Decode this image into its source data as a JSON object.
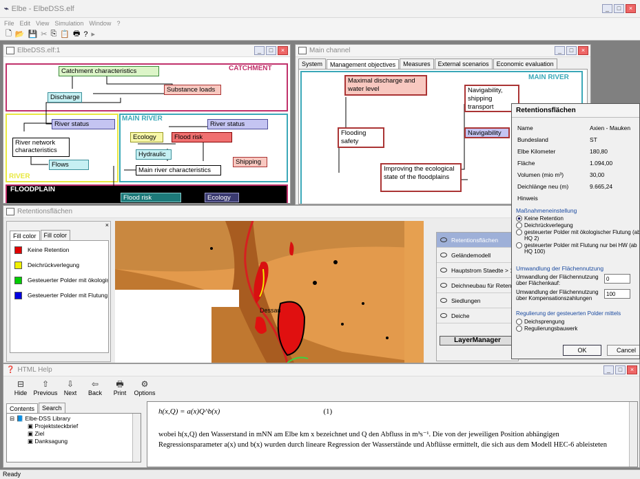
{
  "app": {
    "title": "Elbe - ElbeDSS.elf",
    "menu": [
      "File",
      "Edit",
      "View",
      "Simulation",
      "Window",
      "?"
    ],
    "status": "Ready"
  },
  "toolbar": {
    "icons": [
      "new-icon",
      "open-icon",
      "save-icon",
      "cut-icon",
      "copy-icon",
      "paste-icon",
      "print-icon",
      "help-icon",
      "run-icon"
    ]
  },
  "model_window": {
    "title": "ElbeDSS.elf:1",
    "regions": {
      "catchment": "CATCHMENT",
      "main_river": "MAIN RIVER",
      "river": "RIVER",
      "floodplain": "FLOODPLAIN"
    },
    "boxes": {
      "catchment_characteristics": "Catchment characteristics",
      "discharge": "Discharge",
      "substance_loads": "Substance loads",
      "river_status": "River status",
      "river_network": "River network characteristics",
      "flows": "Flows",
      "ecology": "Ecology",
      "flood_risk": "Flood risk",
      "main_river_status": "River status",
      "hydraulic": "Hydraulic",
      "shipping": "Shipping",
      "main_river_characteristics": "Main river characteristics",
      "fp_flood_risk": "Flood risk",
      "fp_ecology": "Ecology"
    }
  },
  "main_channel": {
    "title": "Main channel",
    "tabs": [
      "System",
      "Management objectives",
      "Measures",
      "External scenarios",
      "Economic evaluation"
    ],
    "active_tab": 1,
    "region": "MAIN RIVER",
    "boxes": {
      "maximal": "Maximal discharge and water level",
      "navigability_ship": "Navigability, shipping transport capacity",
      "flooding": "Flooding safety",
      "navigability": "Navigability",
      "improving": "Improving the ecological state of the floodplains"
    }
  },
  "retention_window": {
    "title": "Retentionsflächen",
    "legend_tabs": [
      "Fill color",
      "Fill color"
    ],
    "legend": [
      {
        "label": "Keine Retention",
        "color": "#e00000"
      },
      {
        "label": "Deichrückverlegung",
        "color": "#f0f000"
      },
      {
        "label": "Gesteuerter Polder mit ökologis",
        "color": "#00cc00"
      },
      {
        "label": "Gesteuerter Polder mit Flutung ü",
        "color": "#0000e0"
      }
    ],
    "map_label": "Dessau",
    "layers": [
      "Retentionsflächen",
      "Geländemodell",
      "Hauptstrom Staedte > 1",
      "Deichneubau für Reten",
      "Siedlungen",
      "Deiche"
    ],
    "layer_manager": "LayerManager"
  },
  "dialog": {
    "title": "Retentionsflächen",
    "fields": [
      {
        "label": "Name",
        "value": "Axien - Mauken"
      },
      {
        "label": "Bundesland",
        "value": "ST"
      },
      {
        "label": "Elbe Kilometer",
        "value": "180,80"
      },
      {
        "label": "Fläche",
        "value": "1.094,00"
      },
      {
        "label": "Volumen (mio m³)",
        "value": "30,00"
      },
      {
        "label": "Deichlänge neu (m)",
        "value": "9.665,24"
      },
      {
        "label": "Hinweis",
        "value": ""
      }
    ],
    "group1": "Maßnahmeneinstellung",
    "radios1": [
      "Keine Retention",
      "Deichrückverlegung",
      "gesteuerter Polder mit ökologischer Flutung (ab HQ 2)",
      "gesteuerter Polder mit Flutung nur bei HW (ab HQ 100)"
    ],
    "group2": "Umwandlung der Flächennutzung",
    "conv1_label": "Umwandlung der Flächennutzung über Flächenkauf:",
    "conv1_value": "0",
    "conv2_label": "Umwandlung der Flächennutzung über Kompensationszahlungen",
    "conv2_value": "100",
    "group3": "Regulierung der gesteuerten Polder mittels",
    "radios3": [
      "Deichsprengung",
      "Regulierungsbauwerk"
    ],
    "ok": "OK",
    "cancel": "Cancel"
  },
  "help": {
    "title": "HTML Help",
    "buttons": [
      "Hide",
      "Previous",
      "Next",
      "Back",
      "Print",
      "Options"
    ],
    "tabs": [
      "Contents",
      "Search"
    ],
    "tree": [
      "Elbe-DSS Library",
      "Projektsteckbrief",
      "Ziel",
      "Danksagung"
    ],
    "formula": "h(x,Q) = a(x)Q^b(x)",
    "eqnum": "(1)",
    "para": "wobei h(x,Q) den Wasserstand in mNN am Elbe km x bezeichnet und Q den Abfluss in m³s⁻¹. Die von der jeweiligen Position abhängigen Regressionsparameter a(x) und b(x) wurden durch lineare Regression der Wasserstände und Abflüsse ermittelt, die sich aus dem Modell HEC-6 ableisteten"
  },
  "colors": {
    "catchment": "#c0306a",
    "main_river": "#3aa8b8",
    "river": "#e8e840",
    "floodplain": "#000000"
  }
}
